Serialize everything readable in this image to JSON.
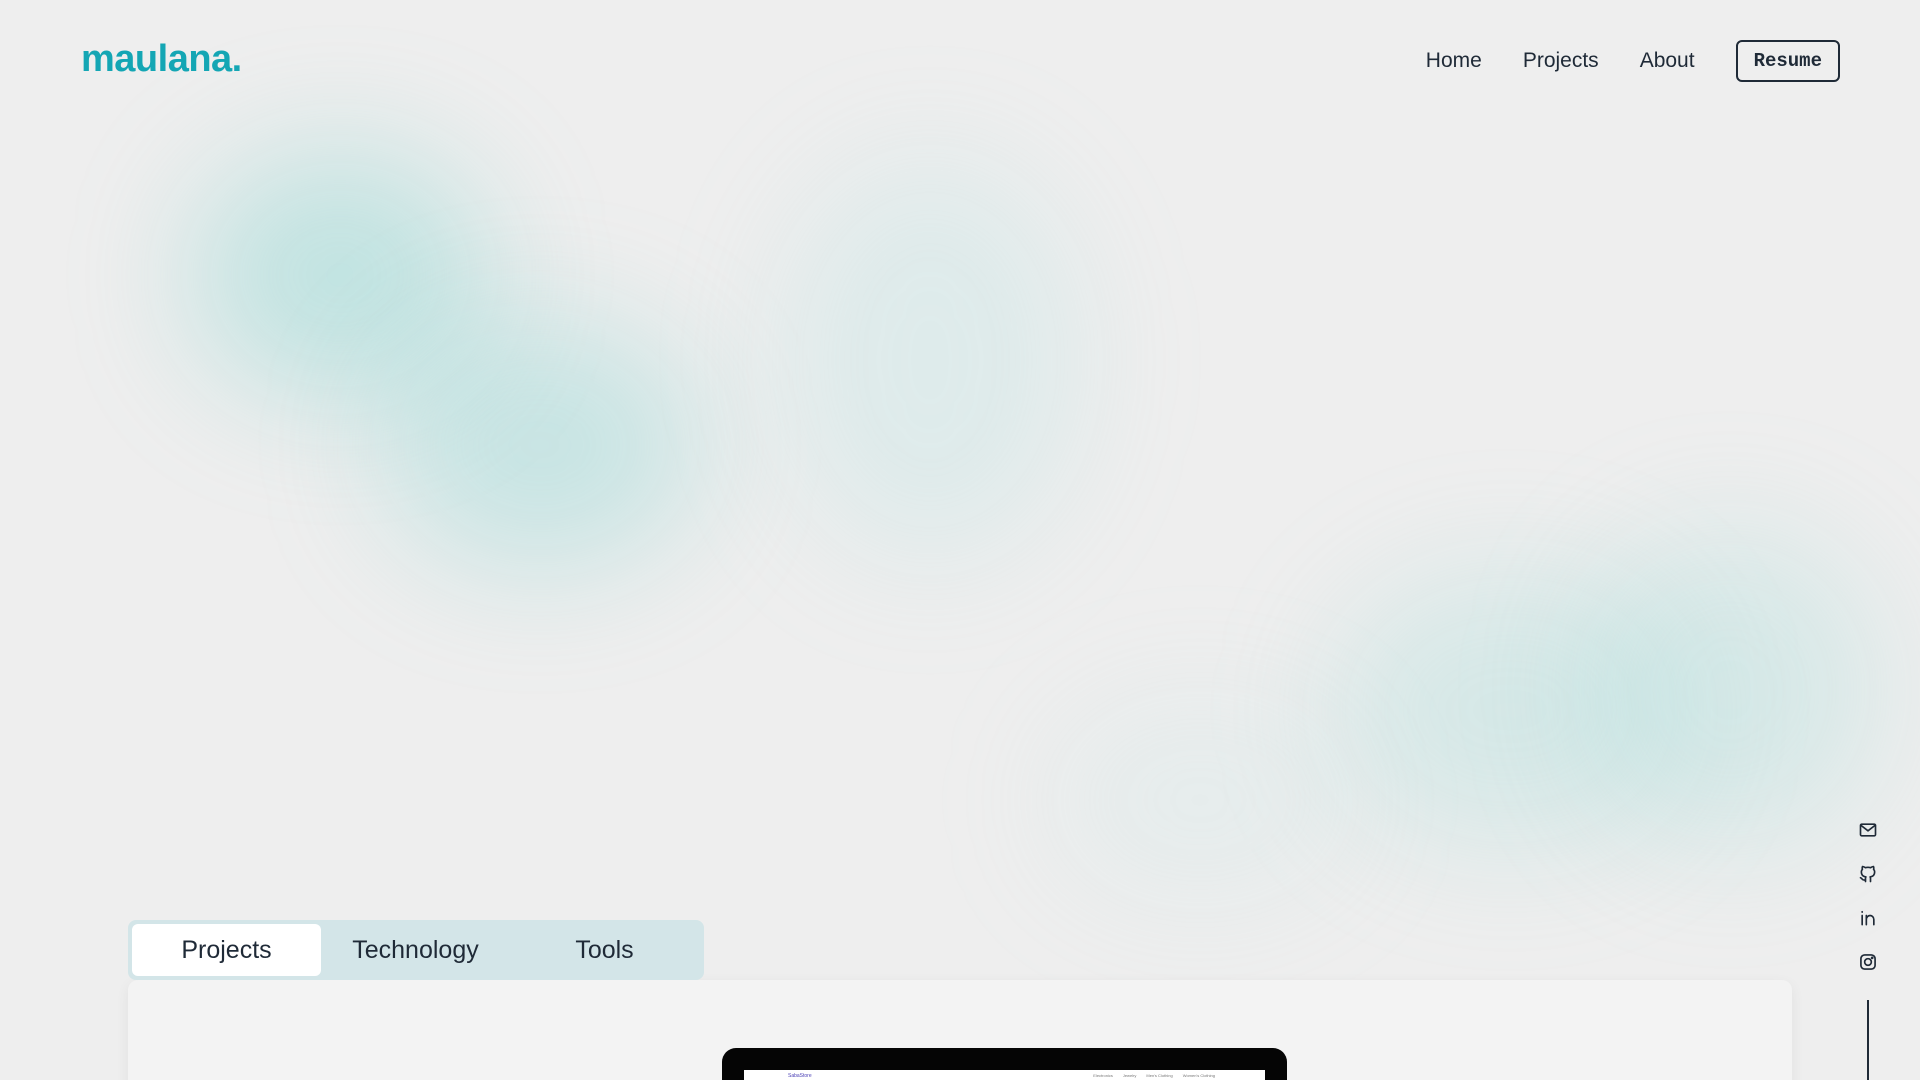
{
  "header": {
    "logo": "maulana.",
    "nav": [
      {
        "label": "Home"
      },
      {
        "label": "Projects"
      },
      {
        "label": "About"
      }
    ],
    "resume_label": "Resume"
  },
  "social": [
    "mail-icon",
    "github-icon",
    "linkedin-icon",
    "instagram-icon"
  ],
  "tabs": [
    {
      "label": "Projects",
      "active": true
    },
    {
      "label": "Technology",
      "active": false
    },
    {
      "label": "Tools",
      "active": false
    }
  ],
  "preview": {
    "site_name": "SabaStore",
    "nav": [
      "Electronics",
      "Jewelry",
      "Men's Clothing",
      "Women's Clothing"
    ]
  },
  "colors": {
    "accent": "#14a6b4",
    "text": "#1f2a37",
    "background": "#eeeeee",
    "tabs_bg": "#d3e5e8"
  }
}
